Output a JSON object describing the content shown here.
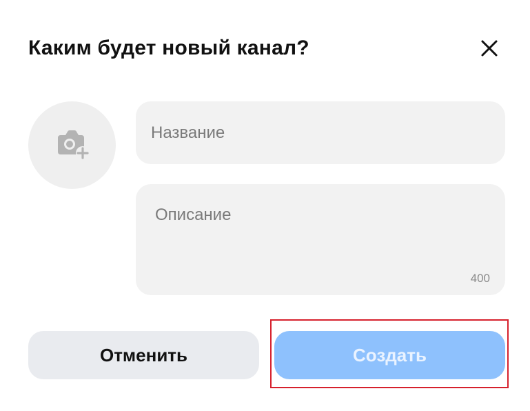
{
  "dialog": {
    "title": "Каким будет новый канал?",
    "close_icon": "close-icon"
  },
  "avatar": {
    "icon": "camera-plus-icon"
  },
  "form": {
    "name_placeholder": "Название",
    "name_value": "",
    "description_placeholder": "Описание",
    "description_value": "",
    "description_counter": "400"
  },
  "actions": {
    "cancel_label": "Отменить",
    "create_label": "Создать"
  },
  "colors": {
    "field_bg": "#f2f2f2",
    "avatar_bg": "#efefef",
    "cancel_bg": "#e9ebef",
    "create_bg_disabled": "#8ec1fd",
    "highlight": "#d6202c"
  }
}
